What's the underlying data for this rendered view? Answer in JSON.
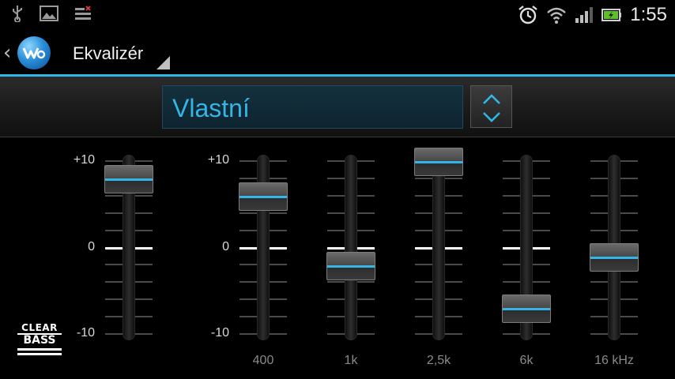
{
  "status_bar": {
    "time": "1:55",
    "icons": [
      "usb-icon",
      "image-icon",
      "tasks-icon",
      "alarm-icon",
      "wifi-icon",
      "signal-icon",
      "battery-icon"
    ]
  },
  "action_bar": {
    "title": "Ekvalizér",
    "icons": [
      "back-icon",
      "walkman-app-icon",
      "dropdown-triangle-icon"
    ]
  },
  "preset": {
    "value": "Vlastní",
    "accent_color": "#33b5e5"
  },
  "scale": {
    "max_label": "+10",
    "zero_label": "0",
    "min_label": "-10",
    "max": 10,
    "min": -10
  },
  "clear_bass": {
    "label_top": "CLEAR",
    "label_bottom": "BASS",
    "level": 8
  },
  "bands": [
    {
      "freq": "400",
      "level": 6
    },
    {
      "freq": "1k",
      "level": -2
    },
    {
      "freq": "2,5k",
      "level": 10
    },
    {
      "freq": "6k",
      "level": -7
    },
    {
      "freq": "16 kHz",
      "level": -1
    }
  ]
}
